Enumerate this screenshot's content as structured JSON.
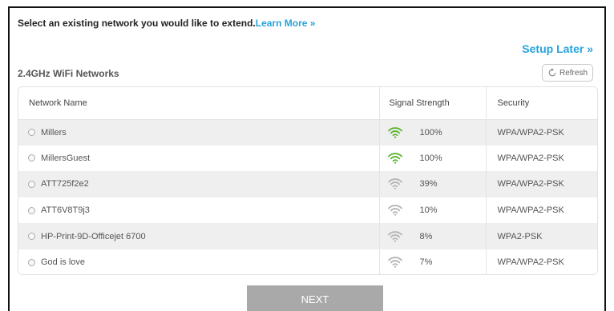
{
  "intro": {
    "text": "Select an existing network you would like to extend.",
    "learn_more": "Learn More »"
  },
  "setup_later": "Setup Later »",
  "section_title": "2.4GHz WiFi Networks",
  "refresh_label": "Refresh",
  "table": {
    "headers": {
      "name": "Network Name",
      "signal": "Signal Strength",
      "security": "Security"
    },
    "rows": [
      {
        "name": "Millers",
        "signal": "100%",
        "security": "WPA/WPA2-PSK",
        "icon": "wifi-strong-icon"
      },
      {
        "name": "MillersGuest",
        "signal": "100%",
        "security": "WPA/WPA2-PSK",
        "icon": "wifi-strong-icon"
      },
      {
        "name": "ATT725f2e2",
        "signal": "39%",
        "security": "WPA/WPA2-PSK",
        "icon": "wifi-weak-icon"
      },
      {
        "name": "ATT6V8T9j3",
        "signal": "10%",
        "security": "WPA/WPA2-PSK",
        "icon": "wifi-weak-icon"
      },
      {
        "name": "HP-Print-9D-Officejet 6700",
        "signal": "8%",
        "security": "WPA2-PSK",
        "icon": "wifi-weak-icon"
      },
      {
        "name": "God is love",
        "signal": "7%",
        "security": "WPA/WPA2-PSK",
        "icon": "wifi-weak-icon"
      }
    ]
  },
  "next_label": "NEXT",
  "colors": {
    "accent": "#26a3dc",
    "wifi_strong": "#5bb52f",
    "wifi_weak": "#b5b5b5",
    "next_button": "#a9a9a9"
  }
}
